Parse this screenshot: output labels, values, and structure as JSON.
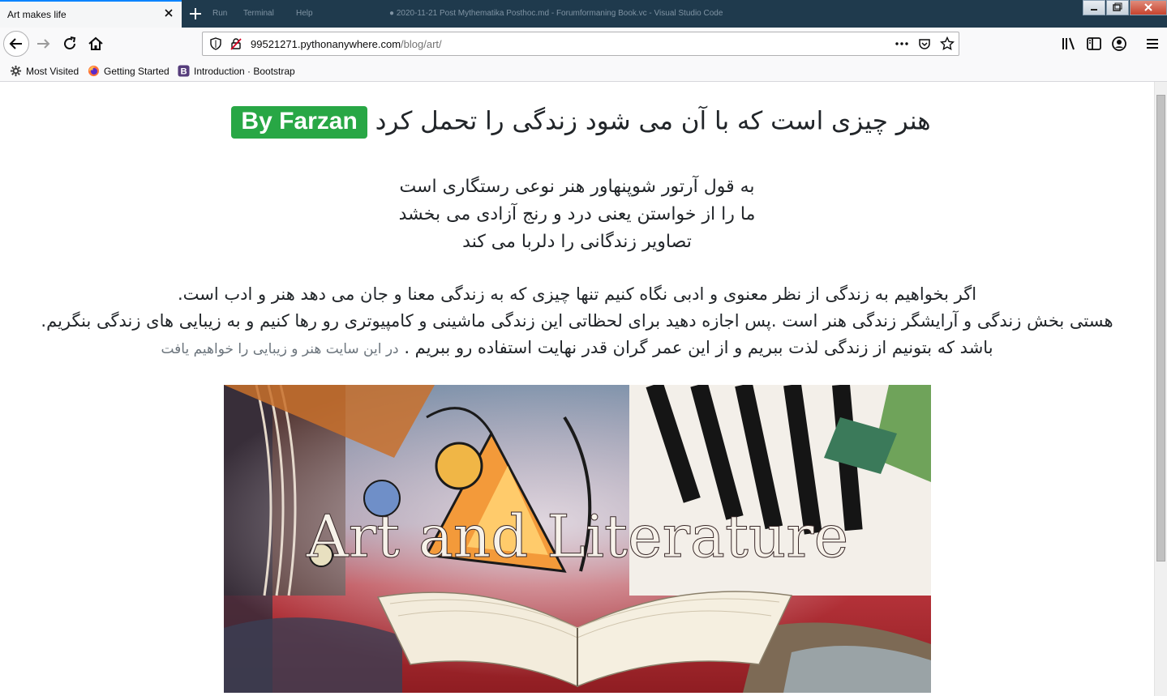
{
  "browser": {
    "tab_title": "Art makes life",
    "bg_titlebar_text": {
      "menu_run": "Run",
      "menu_terminal": "Terminal",
      "menu_help": "Help",
      "vscode_title": "● 2020-11-21 Post Mythematika Posthoc.md - Forumformaning Book.vc - Visual Studio Code"
    },
    "url_host": "99521271.pythonanywhere.com",
    "url_path": "/blog/art/",
    "bookmarks": [
      {
        "label": "Most Visited",
        "icon": "gear-icon"
      },
      {
        "label": "Getting Started",
        "icon": "firefox-icon"
      },
      {
        "label": "Introduction · Bootstrap",
        "icon": "bootstrap-icon"
      }
    ]
  },
  "page": {
    "heading_text": "هنر چیزی است که با آن می شود زندگی را تحمل کرد",
    "badge_text": "By Farzan",
    "poem_lines": [
      "به قول آرتور شوپنهاور هنر نوعی رستگاری است",
      "ما را از خواستن یعنی درد و رنج آزادی می بخشد",
      "تصاویر زندگانی را دلربا می کند"
    ],
    "paragraph_lines": [
      "اگر بخواهیم به زندگی از نظر معنوی و ادبی نگاه کنیم تنها چیزی که به زندگی معنا و جان می دهد هنر و ادب است.",
      "هستی بخش زندگی و آرایشگر زندگی هنر است .پس اجازه دهید برای لحظاتی این زندگی ماشینی و کامپیوتری رو رها کنیم و به زیبایی های زندگی بنگریم.",
      "باشد که بتونیم از زندگی لذت ببریم و از این عمر گران قدر نهایت استفاده رو ببریم ."
    ],
    "muted_text": "در این سایت هنر و زیبایی را خواهیم یافت",
    "image_caption": "Art and Literature"
  },
  "colors": {
    "badge_bg": "#28a745",
    "titlebar_bg": "#1f3a4d",
    "tab_accent": "#0a84ff"
  }
}
